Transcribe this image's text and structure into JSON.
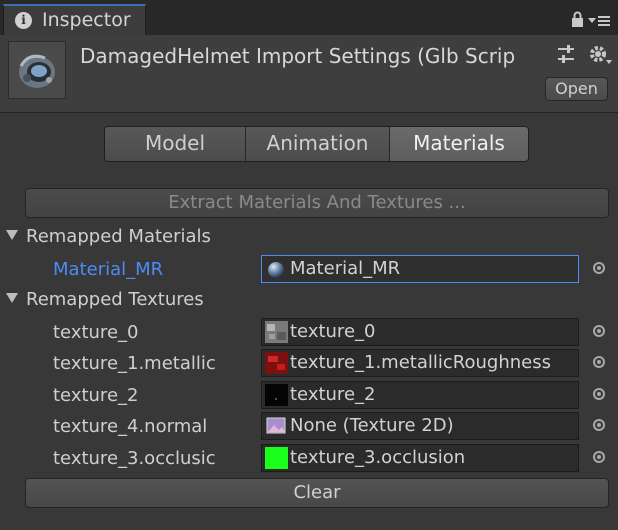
{
  "window": {
    "tab_title": "Inspector",
    "info_icon": "i",
    "tab_icons": [
      "lock-icon",
      "menu-icon"
    ]
  },
  "header": {
    "title": "DamagedHelmet Import Settings (Glb Scrip",
    "open_label": "Open",
    "icons": [
      "preset-sliders-icon",
      "gear-icon"
    ]
  },
  "tabs": {
    "model": "Model",
    "animation": "Animation",
    "materials": "Materials",
    "active": "Materials"
  },
  "extract_label": "Extract Materials And Textures ...",
  "remapped_materials": {
    "heading": "Remapped Materials",
    "items": [
      {
        "label": "Material_MR",
        "value": "Material_MR",
        "icon": "material-sphere-icon"
      }
    ]
  },
  "remapped_textures": {
    "heading": "Remapped Textures",
    "items": [
      {
        "label": "texture_0",
        "value": "texture_0",
        "swatch": "#8a8a8a"
      },
      {
        "label": "texture_1.metallic",
        "value": "texture_1.metallicRoughness",
        "swatch": "#b41e1e"
      },
      {
        "label": "texture_2",
        "value": "texture_2",
        "swatch": "#050505"
      },
      {
        "label": "texture_4.normal",
        "value": "None (Texture 2D)",
        "swatch": "#9a86c4"
      },
      {
        "label": "texture_3.occlusic",
        "value": "texture_3.occlusion",
        "swatch": "#19ff19"
      }
    ]
  },
  "clear_label": "Clear",
  "colors": {
    "accent_blue": "#3d6fb6",
    "material_label_blue": "#4a8cf7",
    "background": "#383838"
  }
}
